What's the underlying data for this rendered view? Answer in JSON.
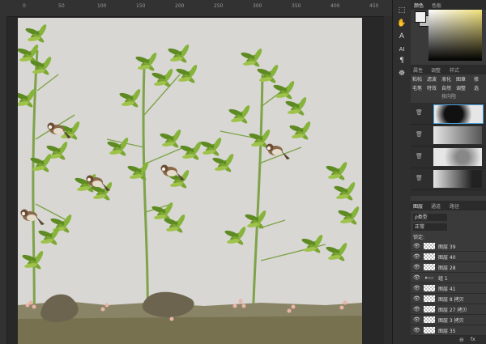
{
  "ruler": {
    "marks": [
      "0",
      "50",
      "100",
      "150",
      "200",
      "250",
      "300",
      "350",
      "400",
      "450"
    ]
  },
  "tools": [
    {
      "icon": "frame-icon",
      "glyph": "⬚"
    },
    {
      "icon": "hand-icon",
      "glyph": "✋"
    },
    {
      "icon": "paragraph-style-icon",
      "glyph": "A"
    },
    {
      "icon": "text-icon",
      "glyph": "AI"
    },
    {
      "icon": "paragraph-icon",
      "glyph": "¶"
    },
    {
      "icon": "puppet-icon",
      "glyph": "☸"
    }
  ],
  "color_panel": {
    "tabs": [
      "颜色",
      "色板"
    ]
  },
  "adjust_panel": {
    "tabs": [
      "属性",
      "调整",
      "样式"
    ],
    "buttons_row1": [
      "粘帖",
      "滤波",
      "液化",
      "图章",
      "修"
    ],
    "buttons_row2": [
      "毛笔",
      "特效",
      "自然",
      "调整",
      "选"
    ],
    "sub_label": "按向阻"
  },
  "layers_panel": {
    "tabs": [
      "图层",
      "通道",
      "路径"
    ],
    "filter": "ρ类型",
    "blend_mode": "正常",
    "lock_label": "锁定:",
    "layers": [
      {
        "name": "图层 39",
        "selected": false
      },
      {
        "name": "图层 40",
        "selected": false
      },
      {
        "name": "图层 28",
        "selected": false
      },
      {
        "name": "组 1",
        "selected": false
      },
      {
        "name": "图层 41",
        "selected": false
      },
      {
        "name": "图层 8 拷贝",
        "selected": false
      },
      {
        "name": "图层 27 拷贝",
        "selected": false
      },
      {
        "name": "图层 3 拷贝",
        "selected": false
      },
      {
        "name": "图层 35",
        "selected": false
      }
    ],
    "footer_icons": [
      "link-icon",
      "fx-icon"
    ]
  }
}
